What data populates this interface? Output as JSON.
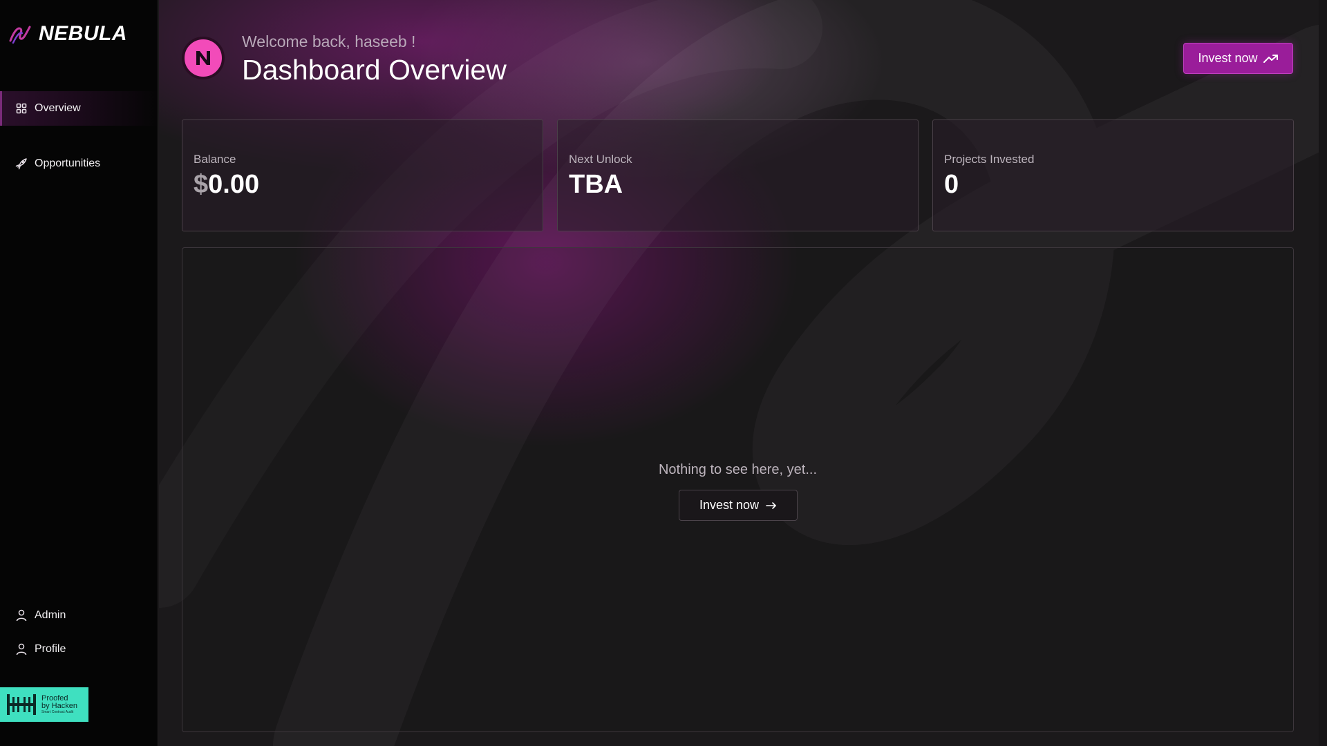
{
  "brand": {
    "name": "NEBULA"
  },
  "sidebar": {
    "nav": [
      {
        "label": "Overview",
        "icon": "grid-icon"
      },
      {
        "label": "Opportunities",
        "icon": "rocket-icon"
      }
    ],
    "bottom": [
      {
        "label": "Admin",
        "icon": "user-icon"
      },
      {
        "label": "Profile",
        "icon": "user-icon"
      }
    ],
    "audit_badge": {
      "line1": "Proofed",
      "line2": "by Hacken",
      "line3": "Smart Contract Audit"
    }
  },
  "header": {
    "welcome": "Welcome back, haseeb !",
    "title": "Dashboard Overview",
    "invest_button": "Invest now"
  },
  "stats": [
    {
      "label": "Balance",
      "currency": "$",
      "value": "0.00"
    },
    {
      "label": "Next Unlock",
      "value": "TBA"
    },
    {
      "label": "Projects Invested",
      "value": "0"
    }
  ],
  "panel": {
    "empty_message": "Nothing to see here, yet...",
    "invest_button": "Invest now"
  },
  "colors": {
    "accent": "#9a1d9a",
    "logo_pink": "#f24bb9",
    "audit_badge": "#3fe0c0",
    "sidebar_bg": "#050505"
  }
}
